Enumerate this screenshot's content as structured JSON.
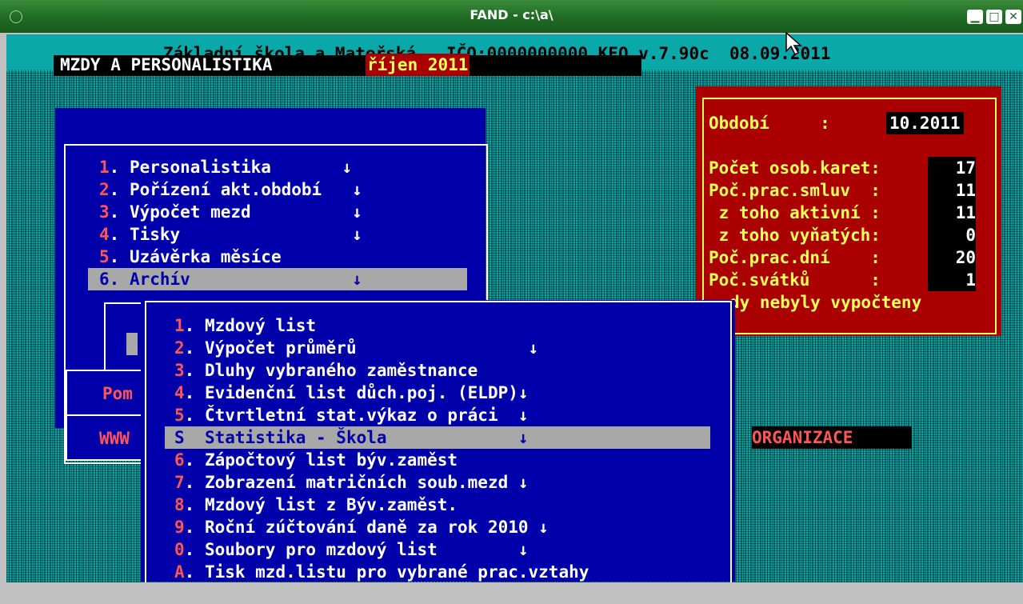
{
  "window": {
    "title": "FAND - c:\\a\\",
    "buttons": {
      "minimize": "▁",
      "maximize": "□",
      "close": "✕"
    }
  },
  "header": {
    "line": "Základní škola a Mateřská   IČO:0000000000 KEO v.7.90c  08.09.2011"
  },
  "app": {
    "title": "MZDY A PERSONALISTIKA",
    "period_label": "říjen 2011"
  },
  "main_menu": {
    "items": [
      {
        "num": "1",
        "label": ". Personalistika       ↓"
      },
      {
        "num": "2",
        "label": ". Pořízení akt.období   ↓"
      },
      {
        "num": "3",
        "label": ". Výpočet mezd          ↓"
      },
      {
        "num": "4",
        "label": ". Tisky                 ↓"
      },
      {
        "num": "5",
        "label": ". Uzávěrka měsíce"
      },
      {
        "num": "6",
        "label": ". Archív                ↓"
      }
    ]
  },
  "info": {
    "obdobi_label": "Období     :",
    "obdobi_value": "10.2011",
    "rows": [
      {
        "label": "Počet osob.karet:",
        "value": "17"
      },
      {
        "label": "Poč.prac.smluv  :",
        "value": "11"
      },
      {
        "label": " z toho aktivní :",
        "value": "11"
      },
      {
        "label": " z toho vyňatých:",
        "value": "0"
      },
      {
        "label": "Poč.prac.dní    :",
        "value": "20"
      },
      {
        "label": "Poč.svátků      :",
        "value": "1"
      }
    ],
    "note": "dy nebyly vypočteny"
  },
  "left_fragments": {
    "pom": "Pom",
    "www": "WWW"
  },
  "org_label": "ORGANIZACE",
  "submenu": {
    "items": [
      {
        "num": "1",
        "label": ". Mzdový list"
      },
      {
        "num": "2",
        "label": ". Výpočet průměrů                 ↓"
      },
      {
        "num": "3",
        "label": ". Dluhy vybraného zaměstnance"
      },
      {
        "num": "4",
        "label": ". Evidenční list důch.poj. (ELDP)↓"
      },
      {
        "num": "5",
        "label": ". Čtvrtletní stat.výkaz o práci  ↓"
      },
      {
        "num": "S",
        "label": "  Statistika - Škola             ↓"
      },
      {
        "num": "6",
        "label": ". Zápočtový list býv.zaměst"
      },
      {
        "num": "7",
        "label": ". Zobrazení matričních soub.mezd ↓"
      },
      {
        "num": "8",
        "label": ". Mzdový list z Býv.zaměst."
      },
      {
        "num": "9",
        "label": ". Roční zúčtování daně za rok 2010 ↓"
      },
      {
        "num": "0",
        "label": ". Soubory pro mzdový list        ↓"
      },
      {
        "num": "A",
        "label": ". Tisk mzd.listu pro vybrané prac.vztahy"
      }
    ]
  }
}
